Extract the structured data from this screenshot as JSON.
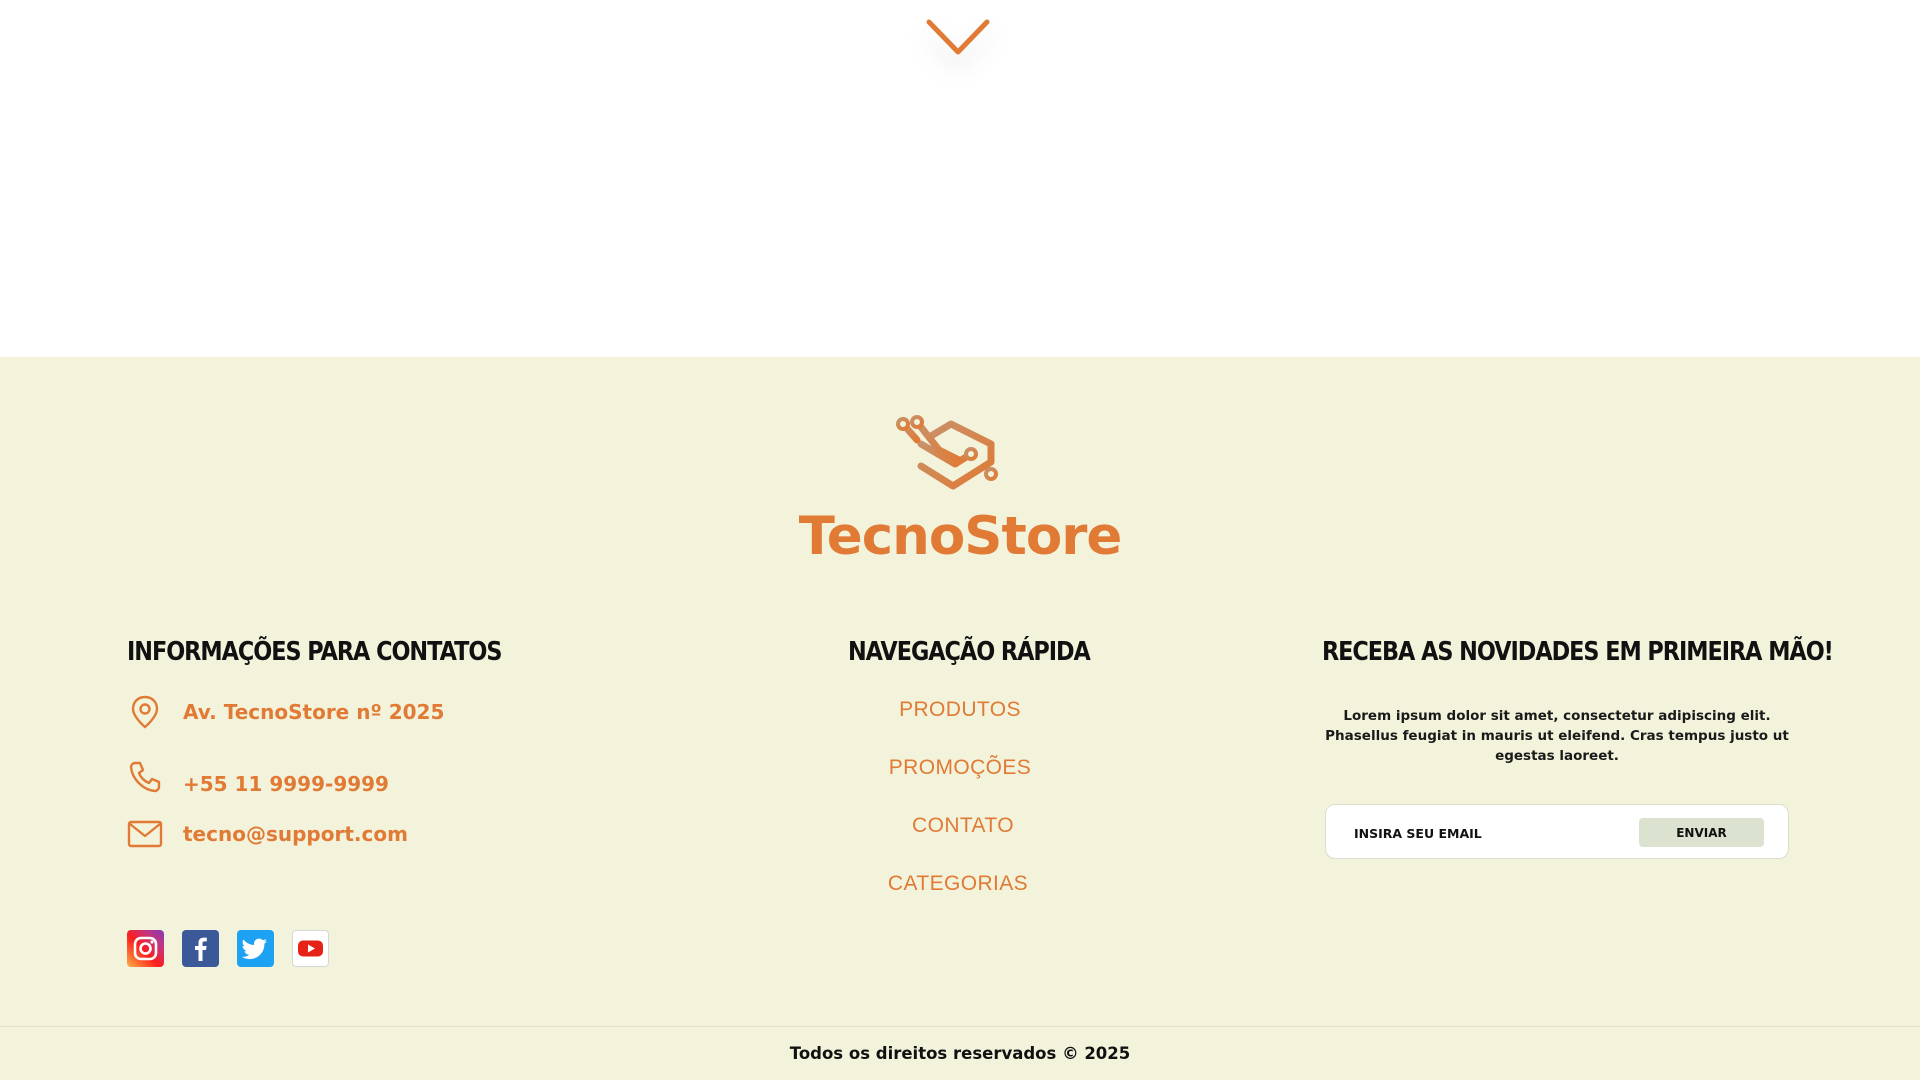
{
  "brand": {
    "name": "TecnoStore",
    "color": "#e07a35"
  },
  "icons": {
    "scroll": "chevron-down-icon",
    "logo": "logo-icon",
    "address": "location-pin-icon",
    "phone": "phone-icon",
    "email": "mail-icon"
  },
  "contact": {
    "title": "INFORMAÇÕES PARA CONTATOS",
    "address": "Av. TecnoStore nº 2025",
    "phone": "+55 11 9999-9999",
    "email": "tecno@support.com"
  },
  "social": [
    "instagram-icon",
    "facebook-icon",
    "twitter-icon",
    "youtube-icon"
  ],
  "nav": {
    "title": "NAVEGAÇÃO RÁPIDA",
    "links": [
      "PRODUTOS",
      "PROMOÇÕES",
      "CONTATO",
      "CATEGORIAS"
    ]
  },
  "newsletter": {
    "title": "RECEBA AS NOVIDADES EM PRIMEIRA MÃO!",
    "description": "Lorem ipsum dolor sit amet, consectetur adipiscing elit. Phasellus feugiat in mauris ut eleifend. Cras tempus justo ut egestas laoreet.",
    "placeholder": "INSIRA SEU EMAIL",
    "button": "ENVIAR"
  },
  "footer": {
    "copyright": "Todos os direitos reservados © 2025"
  },
  "colors": {
    "accent": "#e07a35",
    "footer_bg": "#f3f3dc",
    "button_bg": "#dbe2cf"
  }
}
